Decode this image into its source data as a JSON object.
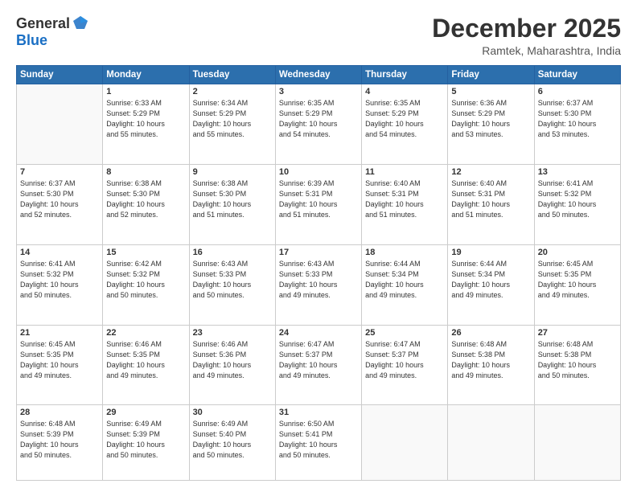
{
  "header": {
    "logo_general": "General",
    "logo_blue": "Blue",
    "month_title": "December 2025",
    "location": "Ramtek, Maharashtra, India"
  },
  "weekdays": [
    "Sunday",
    "Monday",
    "Tuesday",
    "Wednesday",
    "Thursday",
    "Friday",
    "Saturday"
  ],
  "weeks": [
    [
      {
        "day": "",
        "info": ""
      },
      {
        "day": "1",
        "info": "Sunrise: 6:33 AM\nSunset: 5:29 PM\nDaylight: 10 hours\nand 55 minutes."
      },
      {
        "day": "2",
        "info": "Sunrise: 6:34 AM\nSunset: 5:29 PM\nDaylight: 10 hours\nand 55 minutes."
      },
      {
        "day": "3",
        "info": "Sunrise: 6:35 AM\nSunset: 5:29 PM\nDaylight: 10 hours\nand 54 minutes."
      },
      {
        "day": "4",
        "info": "Sunrise: 6:35 AM\nSunset: 5:29 PM\nDaylight: 10 hours\nand 54 minutes."
      },
      {
        "day": "5",
        "info": "Sunrise: 6:36 AM\nSunset: 5:29 PM\nDaylight: 10 hours\nand 53 minutes."
      },
      {
        "day": "6",
        "info": "Sunrise: 6:37 AM\nSunset: 5:30 PM\nDaylight: 10 hours\nand 53 minutes."
      }
    ],
    [
      {
        "day": "7",
        "info": "Sunrise: 6:37 AM\nSunset: 5:30 PM\nDaylight: 10 hours\nand 52 minutes."
      },
      {
        "day": "8",
        "info": "Sunrise: 6:38 AM\nSunset: 5:30 PM\nDaylight: 10 hours\nand 52 minutes."
      },
      {
        "day": "9",
        "info": "Sunrise: 6:38 AM\nSunset: 5:30 PM\nDaylight: 10 hours\nand 51 minutes."
      },
      {
        "day": "10",
        "info": "Sunrise: 6:39 AM\nSunset: 5:31 PM\nDaylight: 10 hours\nand 51 minutes."
      },
      {
        "day": "11",
        "info": "Sunrise: 6:40 AM\nSunset: 5:31 PM\nDaylight: 10 hours\nand 51 minutes."
      },
      {
        "day": "12",
        "info": "Sunrise: 6:40 AM\nSunset: 5:31 PM\nDaylight: 10 hours\nand 51 minutes."
      },
      {
        "day": "13",
        "info": "Sunrise: 6:41 AM\nSunset: 5:32 PM\nDaylight: 10 hours\nand 50 minutes."
      }
    ],
    [
      {
        "day": "14",
        "info": "Sunrise: 6:41 AM\nSunset: 5:32 PM\nDaylight: 10 hours\nand 50 minutes."
      },
      {
        "day": "15",
        "info": "Sunrise: 6:42 AM\nSunset: 5:32 PM\nDaylight: 10 hours\nand 50 minutes."
      },
      {
        "day": "16",
        "info": "Sunrise: 6:43 AM\nSunset: 5:33 PM\nDaylight: 10 hours\nand 50 minutes."
      },
      {
        "day": "17",
        "info": "Sunrise: 6:43 AM\nSunset: 5:33 PM\nDaylight: 10 hours\nand 49 minutes."
      },
      {
        "day": "18",
        "info": "Sunrise: 6:44 AM\nSunset: 5:34 PM\nDaylight: 10 hours\nand 49 minutes."
      },
      {
        "day": "19",
        "info": "Sunrise: 6:44 AM\nSunset: 5:34 PM\nDaylight: 10 hours\nand 49 minutes."
      },
      {
        "day": "20",
        "info": "Sunrise: 6:45 AM\nSunset: 5:35 PM\nDaylight: 10 hours\nand 49 minutes."
      }
    ],
    [
      {
        "day": "21",
        "info": "Sunrise: 6:45 AM\nSunset: 5:35 PM\nDaylight: 10 hours\nand 49 minutes."
      },
      {
        "day": "22",
        "info": "Sunrise: 6:46 AM\nSunset: 5:35 PM\nDaylight: 10 hours\nand 49 minutes."
      },
      {
        "day": "23",
        "info": "Sunrise: 6:46 AM\nSunset: 5:36 PM\nDaylight: 10 hours\nand 49 minutes."
      },
      {
        "day": "24",
        "info": "Sunrise: 6:47 AM\nSunset: 5:37 PM\nDaylight: 10 hours\nand 49 minutes."
      },
      {
        "day": "25",
        "info": "Sunrise: 6:47 AM\nSunset: 5:37 PM\nDaylight: 10 hours\nand 49 minutes."
      },
      {
        "day": "26",
        "info": "Sunrise: 6:48 AM\nSunset: 5:38 PM\nDaylight: 10 hours\nand 49 minutes."
      },
      {
        "day": "27",
        "info": "Sunrise: 6:48 AM\nSunset: 5:38 PM\nDaylight: 10 hours\nand 50 minutes."
      }
    ],
    [
      {
        "day": "28",
        "info": "Sunrise: 6:48 AM\nSunset: 5:39 PM\nDaylight: 10 hours\nand 50 minutes."
      },
      {
        "day": "29",
        "info": "Sunrise: 6:49 AM\nSunset: 5:39 PM\nDaylight: 10 hours\nand 50 minutes."
      },
      {
        "day": "30",
        "info": "Sunrise: 6:49 AM\nSunset: 5:40 PM\nDaylight: 10 hours\nand 50 minutes."
      },
      {
        "day": "31",
        "info": "Sunrise: 6:50 AM\nSunset: 5:41 PM\nDaylight: 10 hours\nand 50 minutes."
      },
      {
        "day": "",
        "info": ""
      },
      {
        "day": "",
        "info": ""
      },
      {
        "day": "",
        "info": ""
      }
    ]
  ]
}
